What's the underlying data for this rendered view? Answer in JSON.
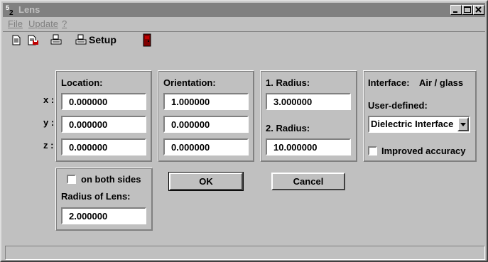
{
  "window": {
    "title": "Lens"
  },
  "menu": {
    "file": "File",
    "update": "Update",
    "help": "?"
  },
  "toolbar": {
    "setup_label": "Setup"
  },
  "location": {
    "label": "Location:",
    "x": "0.000000",
    "y": "0.000000",
    "z": "0.000000"
  },
  "axes": {
    "x": "x :",
    "y": "y :",
    "z": "z :"
  },
  "orientation": {
    "label": "Orientation:",
    "x": "1.000000",
    "y": "0.000000",
    "z": "0.000000"
  },
  "radius": {
    "label1": "1. Radius:",
    "value1": "3.000000",
    "label2": "2. Radius:",
    "value2": "10.000000"
  },
  "interface": {
    "label": "Interface:",
    "value": "Air / glass",
    "user_defined_label": "User-defined:",
    "selected": "Dielectric Interface",
    "improved_accuracy": "Improved accuracy"
  },
  "lens": {
    "both_sides": "on both sides",
    "radius_label": "Radius of Lens:",
    "radius_value": "2.000000"
  },
  "buttons": {
    "ok": "OK",
    "cancel": "Cancel"
  }
}
